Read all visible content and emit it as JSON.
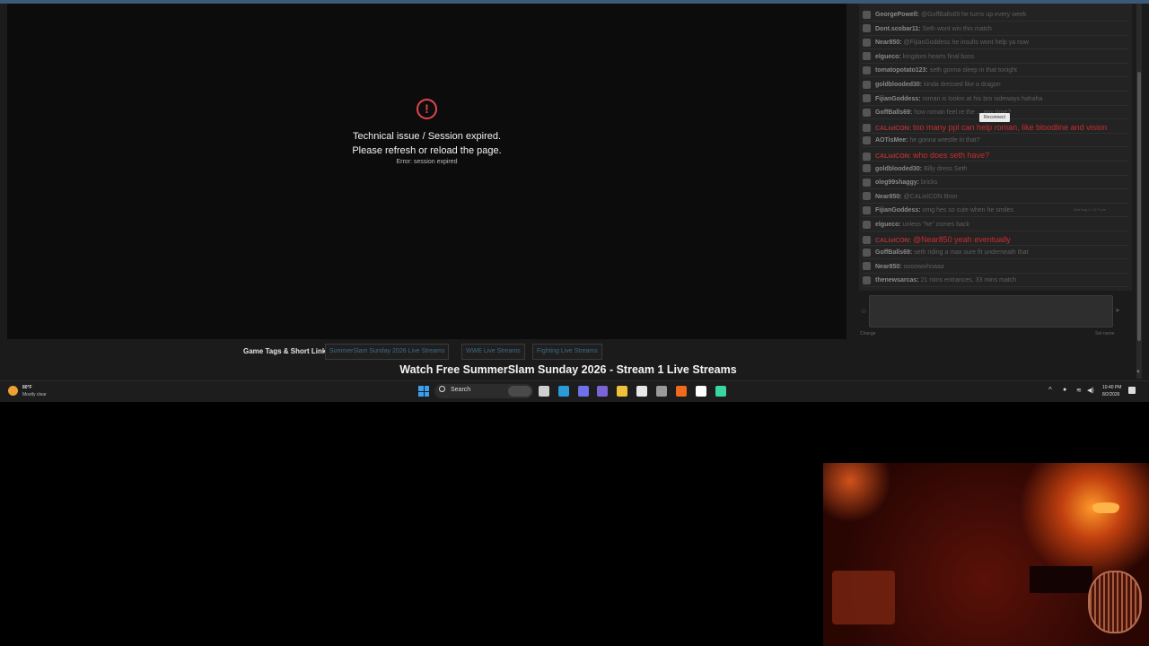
{
  "player": {
    "error_icon": "exclamation-circle-icon",
    "error_line1": "Technical issue / Session expired.",
    "error_line2": "Please refresh or reload the page.",
    "error_code": "Error: session expired"
  },
  "chat": {
    "messages": [
      {
        "user": "GeorgePowell:",
        "text": "@GoffBalls69 he turns up every week",
        "highlight": false
      },
      {
        "user": "Dont.scobar11:",
        "text": "Seth wont win this match",
        "highlight": false
      },
      {
        "user": "Near850:",
        "text": "@FijianGoddess he insults wont help ya now",
        "highlight": false
      },
      {
        "user": "elgueco:",
        "text": "kingdom hearts final boss",
        "highlight": false
      },
      {
        "user": "tomatopotato123:",
        "text": "seth gonna sleep in that tonight",
        "highlight": false
      },
      {
        "user": "goldblooded30:",
        "text": "kinda dressed like a dragon",
        "highlight": false
      },
      {
        "user": "FijianGoddess:",
        "text": "roman is lookin at his bro sideways hahaha",
        "highlight": false
      },
      {
        "user": "GoffBalls69:",
        "text": "how roman feel re the ... any time?",
        "highlight": false
      },
      {
        "user": "CALixICON:",
        "text": "too many ppl can help roman, like bloodline and vision",
        "highlight": true
      },
      {
        "user": "AOTisMee:",
        "text": "he gonna wrestle in that?",
        "highlight": false
      },
      {
        "user": "CALixICON:",
        "text": "who does seth have?",
        "highlight": true
      },
      {
        "user": "goldblooded30:",
        "text": "Billy dress Seth",
        "highlight": false
      },
      {
        "user": "oleg99shaggy:",
        "text": "bricks",
        "highlight": false
      },
      {
        "user": "Near850:",
        "text": "@CALixICON Bron",
        "highlight": false
      },
      {
        "user": "FijianGoddess:",
        "text": "omg hes so cute when he smiles",
        "highlight": false
      },
      {
        "user": "elgueco:",
        "text": "unless \"he\" comes back",
        "highlight": false
      },
      {
        "user": "CALixICON:",
        "text": "@Near850 yeah eventually",
        "highlight": true
      },
      {
        "user": "GoffBalls69:",
        "text": "seth riding a max sure fit underneath that",
        "highlight": false
      },
      {
        "user": "Near850:",
        "text": "oooowwhoaaa",
        "highlight": false
      },
      {
        "user": "thenewsarcas:",
        "text": "21 mins entrances, 33 mins match",
        "highlight": false
      }
    ],
    "reconnect_label": "Reconnect",
    "timestamp": "Sun Aug 2, 10:** pm",
    "change_label": "Change",
    "setname_label": "Set name",
    "left_icon": "smiley-icon",
    "right_icon": "send-icon"
  },
  "tags": {
    "label": "Game Tags & Short Links:",
    "items": [
      "SummerSlam Sunday 2026 Live Streams",
      "WWE Live Streams",
      "Fighting Live Streams"
    ]
  },
  "stream_title": "Watch Free SummerSlam Sunday 2026 - Stream 1 Live Streams",
  "taskbar": {
    "weather_temp": "80°F",
    "weather_desc": "Mostly clear",
    "search_label": "Search",
    "apps": [
      "file-explorer-icon",
      "edge-icon",
      "copilot-icon",
      "teams-icon",
      "folder-icon",
      "store-icon",
      "settings-icon",
      "firefox-icon",
      "tiktok-icon",
      "app-icon"
    ],
    "app_colors": [
      "#cfcfcf",
      "#2a9ad8",
      "#6d72e8",
      "#7b63d8",
      "#f0c23c",
      "#e8e8e8",
      "#9a9a9a",
      "#f06a1c",
      "#ffffff",
      "#3ad6a0"
    ],
    "clock_time": "10:40 PM",
    "clock_date": "8/2/2026"
  }
}
